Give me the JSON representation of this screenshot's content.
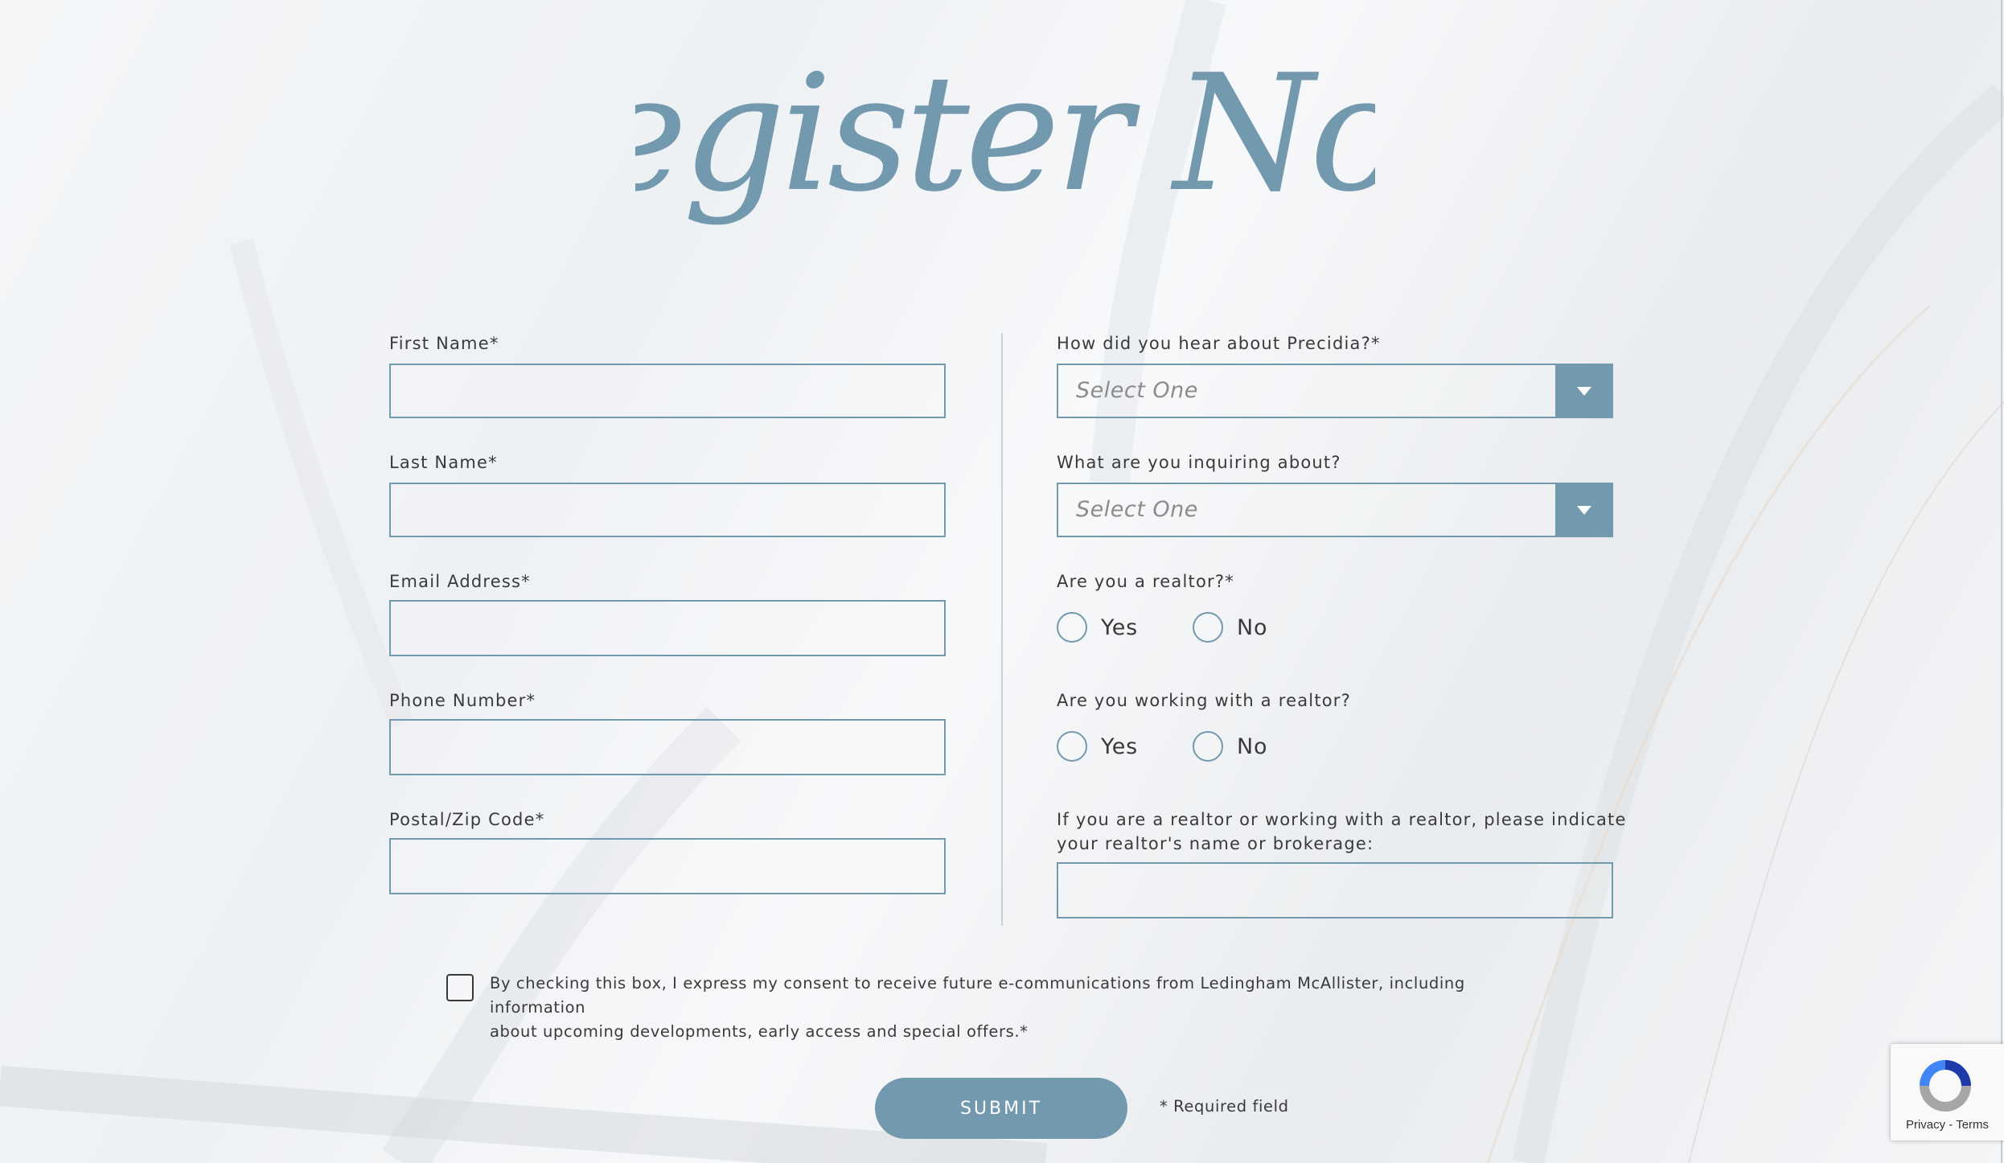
{
  "heading": "Register Now",
  "left_fields": [
    {
      "label": "First Name*",
      "value": "",
      "placeholder": ""
    },
    {
      "label": "Last Name*",
      "value": "",
      "placeholder": ""
    },
    {
      "label": "Email Address*",
      "value": "",
      "placeholder": ""
    },
    {
      "label": "Phone Number*",
      "value": "",
      "placeholder": ""
    },
    {
      "label": "Postal/Zip Code*",
      "value": "",
      "placeholder": ""
    }
  ],
  "hear_about": {
    "label": "How did you hear about Precidia?*",
    "selected": "Select One"
  },
  "inquiring": {
    "label": "What are you inquiring about?",
    "selected": "Select One"
  },
  "is_realtor": {
    "label": "Are you a realtor?*",
    "options": [
      "Yes",
      "No"
    ]
  },
  "working_with_realtor": {
    "label": "Are you working with a realtor?",
    "options": [
      "Yes",
      "No"
    ]
  },
  "realtor_name": {
    "label_line1": "If you are a realtor or working with a realtor, please indicate",
    "label_line2": "your realtor's name or brokerage:",
    "value": ""
  },
  "consent": {
    "line1": "By checking this box, I express my consent to receive future e-communications from Ledingham McAllister, including information",
    "line2": "about upcoming developments, early access and special offers.*",
    "checked": false
  },
  "submit_label": "SUBMIT",
  "required_note": "* Required field",
  "recaptcha": {
    "privacy": "Privacy",
    "separator": " - ",
    "terms": "Terms"
  },
  "colors": {
    "accent": "#7399ae",
    "text": "#3a3a3a",
    "placeholder": "#8c8c8c"
  }
}
